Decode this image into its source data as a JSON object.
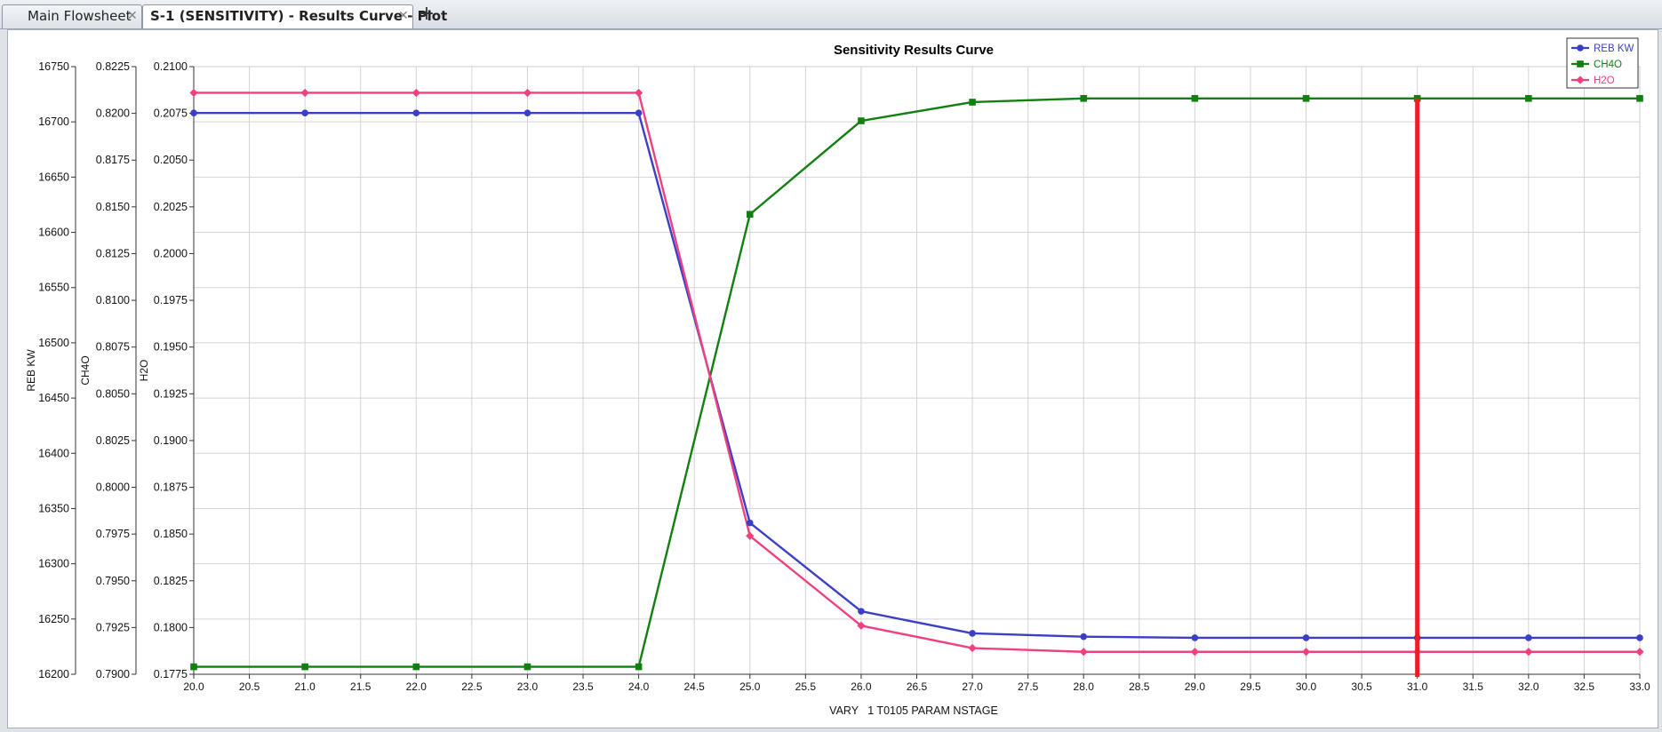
{
  "tabs": [
    {
      "label": "Main Flowsheet"
    },
    {
      "label": "S-1 (SENSITIVITY) - Results Curve - Plot"
    }
  ],
  "tab_add_label": "+",
  "close_glyph": "✕",
  "colors": {
    "reb_kw": "#3b3fc6",
    "ch4o": "#118011",
    "h2o": "#f0407f",
    "marker_line": "#ee1c25",
    "grid": "#d3d3d3"
  },
  "chart_data": {
    "type": "line",
    "title": "Sensitivity Results Curve",
    "xlabel": "VARY   1 T0105 PARAM NSTAGE",
    "xlim": [
      20.0,
      33.0
    ],
    "x": [
      20,
      21,
      22,
      23,
      24,
      25,
      26,
      27,
      28,
      29,
      30,
      31,
      32,
      33
    ],
    "x_ticks": [
      "20.0",
      "20.5",
      "21.0",
      "21.5",
      "22.0",
      "22.5",
      "23.0",
      "23.5",
      "24.0",
      "24.5",
      "25.0",
      "25.5",
      "26.0",
      "26.5",
      "27.0",
      "27.5",
      "28.0",
      "28.5",
      "29.0",
      "29.5",
      "30.0",
      "30.5",
      "31.0",
      "31.5",
      "32.0",
      "32.5",
      "33.0"
    ],
    "grid": true,
    "legend_position": "top-right",
    "vertical_marker_x": 31.0,
    "axes": [
      {
        "label": "REB KW",
        "ylim": [
          16200,
          16750
        ],
        "ticks": [
          "16200",
          "16250",
          "16300",
          "16350",
          "16400",
          "16450",
          "16500",
          "16550",
          "16600",
          "16650",
          "16700",
          "16750"
        ]
      },
      {
        "label": "CH4O",
        "ylim": [
          0.79,
          0.8225
        ],
        "ticks": [
          "0.7900",
          "0.7925",
          "0.7950",
          "0.7975",
          "0.8000",
          "0.8025",
          "0.8050",
          "0.8075",
          "0.8100",
          "0.8125",
          "0.8150",
          "0.8175",
          "0.8200",
          "0.8225"
        ]
      },
      {
        "label": "H2O",
        "ylim": [
          0.1775,
          0.21
        ],
        "ticks": [
          "0.1775",
          "0.1800",
          "0.1825",
          "0.1850",
          "0.1875",
          "0.1900",
          "0.1925",
          "0.1950",
          "0.1975",
          "0.2000",
          "0.2025",
          "0.2050",
          "0.2075",
          "0.2100"
        ]
      }
    ],
    "series": [
      {
        "name": "REB KW",
        "axis": 0,
        "marker": "circle",
        "values": [
          16708,
          16708,
          16708,
          16708,
          16708,
          16337,
          16257,
          16237,
          16234,
          16233,
          16233,
          16233,
          16233,
          16233
        ]
      },
      {
        "name": "CH4O",
        "axis": 1,
        "marker": "square",
        "values": [
          0.7904,
          0.7904,
          0.7904,
          0.7904,
          0.7904,
          0.8146,
          0.8196,
          0.8206,
          0.8208,
          0.8208,
          0.8208,
          0.8208,
          0.8208,
          0.8208
        ]
      },
      {
        "name": "H2O",
        "axis": 2,
        "marker": "diamond",
        "values": [
          0.2086,
          0.2086,
          0.2086,
          0.2086,
          0.2086,
          0.1849,
          0.1801,
          0.1789,
          0.1787,
          0.1787,
          0.1787,
          0.1787,
          0.1787,
          0.1787
        ]
      }
    ]
  }
}
